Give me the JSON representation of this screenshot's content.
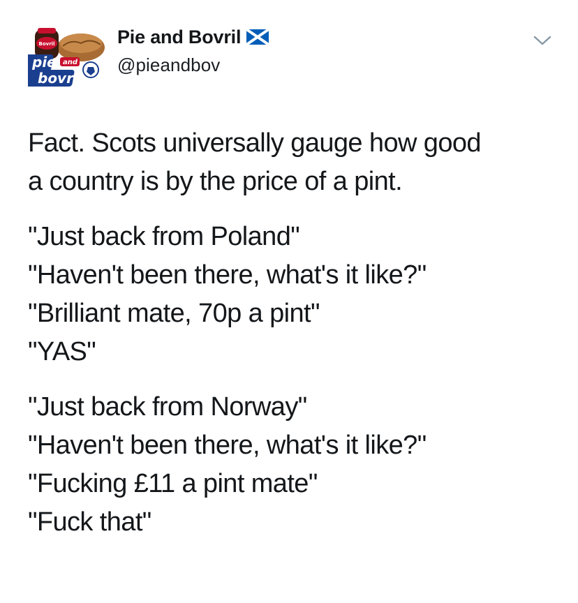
{
  "tweet": {
    "author": {
      "display_name": "Pie and Bovril",
      "handle": "@pieandbov",
      "flag_icon": "scotland-flag-icon",
      "avatar": {
        "jar_label": "Bovril",
        "text_line1": "pie",
        "text_and": "and",
        "text_line2": "bovril"
      }
    },
    "menu_icon": "chevron-down-icon",
    "paragraphs": [
      {
        "lines": [
          "Fact. Scots universally gauge how good",
          "a country is by the price of a pint."
        ]
      },
      {
        "lines": [
          "\"Just back from Poland\"",
          "\"Haven't been there, what's it like?\"",
          "\"Brilliant mate, 70p a pint\"",
          "\"YAS\""
        ]
      },
      {
        "lines": [
          "\"Just back from Norway\"",
          "\"Haven't been there, what's it like?\"",
          "\"Fucking £11 a pint mate\"",
          "\"Fuck that\""
        ]
      }
    ]
  },
  "colors": {
    "text": "#14171a",
    "chevron": "#8899a6",
    "flag_blue": "#005eb8",
    "flag_white": "#ffffff",
    "avatar_blue": "#1b3f8f",
    "avatar_red": "#c8102e"
  }
}
